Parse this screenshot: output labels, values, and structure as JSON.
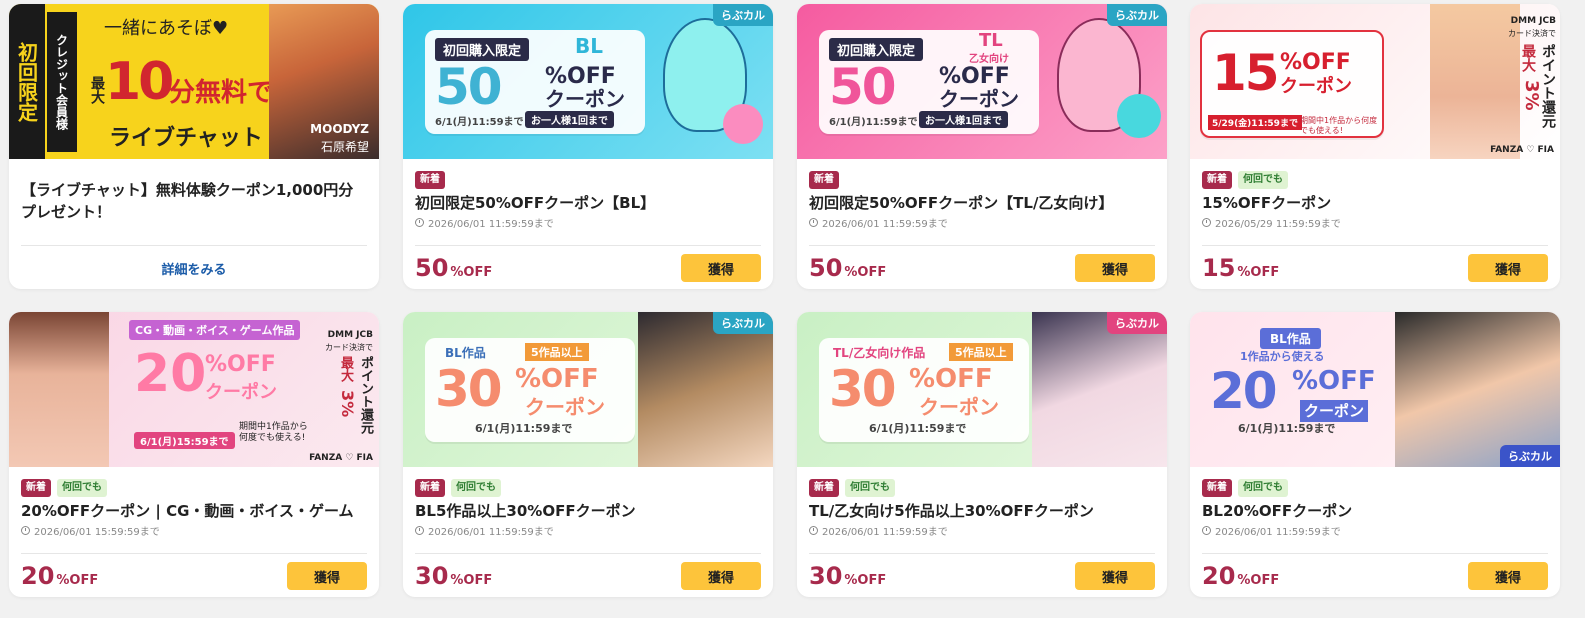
{
  "cards": [
    {
      "banner": {
        "tagline": "一緒にあそぼ♥",
        "side": "クレジット会員様",
        "left_label": "初回限定",
        "big": "10",
        "big_prefix": "最大",
        "big_unit": "分無料で",
        "sub": "ライブチャット",
        "brand": "MOODYZ",
        "name": "石原希望"
      },
      "title": "【ライブチャット】無料体験クーポン1,000円分プレゼント！",
      "link": "詳細をみる"
    },
    {
      "banner": {
        "label": "初回購入限定",
        "genre": "BL",
        "big": "50",
        "off": "%OFF",
        "coupon": "クーポン",
        "deadline": "6/1(月)11:59まで",
        "limit": "お一人様1回まで",
        "ribbon": "らぶカル"
      },
      "tags": {
        "new": "新着"
      },
      "title": "初回限定50%OFFクーポン【BL】",
      "expiry": "2026/06/01 11:59:59まで",
      "discount": "50",
      "unit": "%OFF",
      "button": "獲得"
    },
    {
      "banner": {
        "label": "初回購入限定",
        "genre": "TL",
        "genre2": "乙女向け",
        "big": "50",
        "off": "%OFF",
        "coupon": "クーポン",
        "deadline": "6/1(月)11:59まで",
        "limit": "お一人様1回まで",
        "ribbon": "らぶカル"
      },
      "tags": {
        "new": "新着"
      },
      "title": "初回限定50%OFFクーポン【TL/乙女向け】",
      "expiry": "2026/06/01 11:59:59まで",
      "discount": "50",
      "unit": "%OFF",
      "button": "獲得"
    },
    {
      "banner": {
        "big": "15",
        "off": "%OFF",
        "coupon": "クーポン",
        "deadline": "5/29(金)11:59まで",
        "note": "期間中1作品から何度でも使える!",
        "side1": "DMM JCB",
        "side2": "カード決済で",
        "side3": "最大",
        "side4": "3%",
        "side5": "ポイント還元",
        "brand": "FANZA ♡ FIA"
      },
      "tags": {
        "new": "新着",
        "any": "何回でも"
      },
      "title": "15%OFFクーポン",
      "expiry": "2026/05/29 11:59:59まで",
      "discount": "15",
      "unit": "%OFF",
      "button": "獲得"
    },
    {
      "banner": {
        "label": "CG・動画・ボイス・ゲーム作品",
        "big": "20",
        "off": "%OFF",
        "coupon": "クーポン",
        "deadline": "6/1(月)15:59まで",
        "note": "期間中1作品から何度でも使える!",
        "side1": "DMM JCB",
        "side2": "カード決済で",
        "side3": "最大",
        "side4": "3%",
        "side5": "ポイント還元",
        "brand": "FANZA ♡ FIA"
      },
      "tags": {
        "new": "新着",
        "any": "何回でも"
      },
      "title": "20%OFFクーポン | CG・動画・ボイス・ゲーム",
      "expiry": "2026/06/01 15:59:59まで",
      "discount": "20",
      "unit": "%OFF",
      "button": "獲得"
    },
    {
      "banner": {
        "label": "BL作品",
        "label2": "5作品以上",
        "big": "30",
        "off": "%OFF",
        "coupon": "クーポン",
        "deadline": "6/1(月)11:59まで",
        "ribbon": "らぶカル"
      },
      "tags": {
        "new": "新着",
        "any": "何回でも"
      },
      "title": "BL5作品以上30%OFFクーポン",
      "expiry": "2026/06/01 11:59:59まで",
      "discount": "30",
      "unit": "%OFF",
      "button": "獲得"
    },
    {
      "banner": {
        "label": "TL/乙女向け作品",
        "label2": "5作品以上",
        "big": "30",
        "off": "%OFF",
        "coupon": "クーポン",
        "deadline": "6/1(月)11:59まで",
        "ribbon": "らぶカル"
      },
      "tags": {
        "new": "新着",
        "any": "何回でも"
      },
      "title": "TL/乙女向け5作品以上30%OFFクーポン",
      "expiry": "2026/06/01 11:59:59まで",
      "discount": "30",
      "unit": "%OFF",
      "button": "獲得"
    },
    {
      "banner": {
        "label": "BL作品",
        "label2": "1作品から使える",
        "big": "20",
        "off": "%OFF",
        "coupon": "クーポン",
        "deadline": "6/1(月)11:59まで",
        "ribbon": "らぶカル"
      },
      "tags": {
        "new": "新着",
        "any": "何回でも"
      },
      "title": "BL20%OFFクーポン",
      "expiry": "2026/06/01 11:59:59まで",
      "discount": "20",
      "unit": "%OFF",
      "button": "獲得"
    }
  ]
}
